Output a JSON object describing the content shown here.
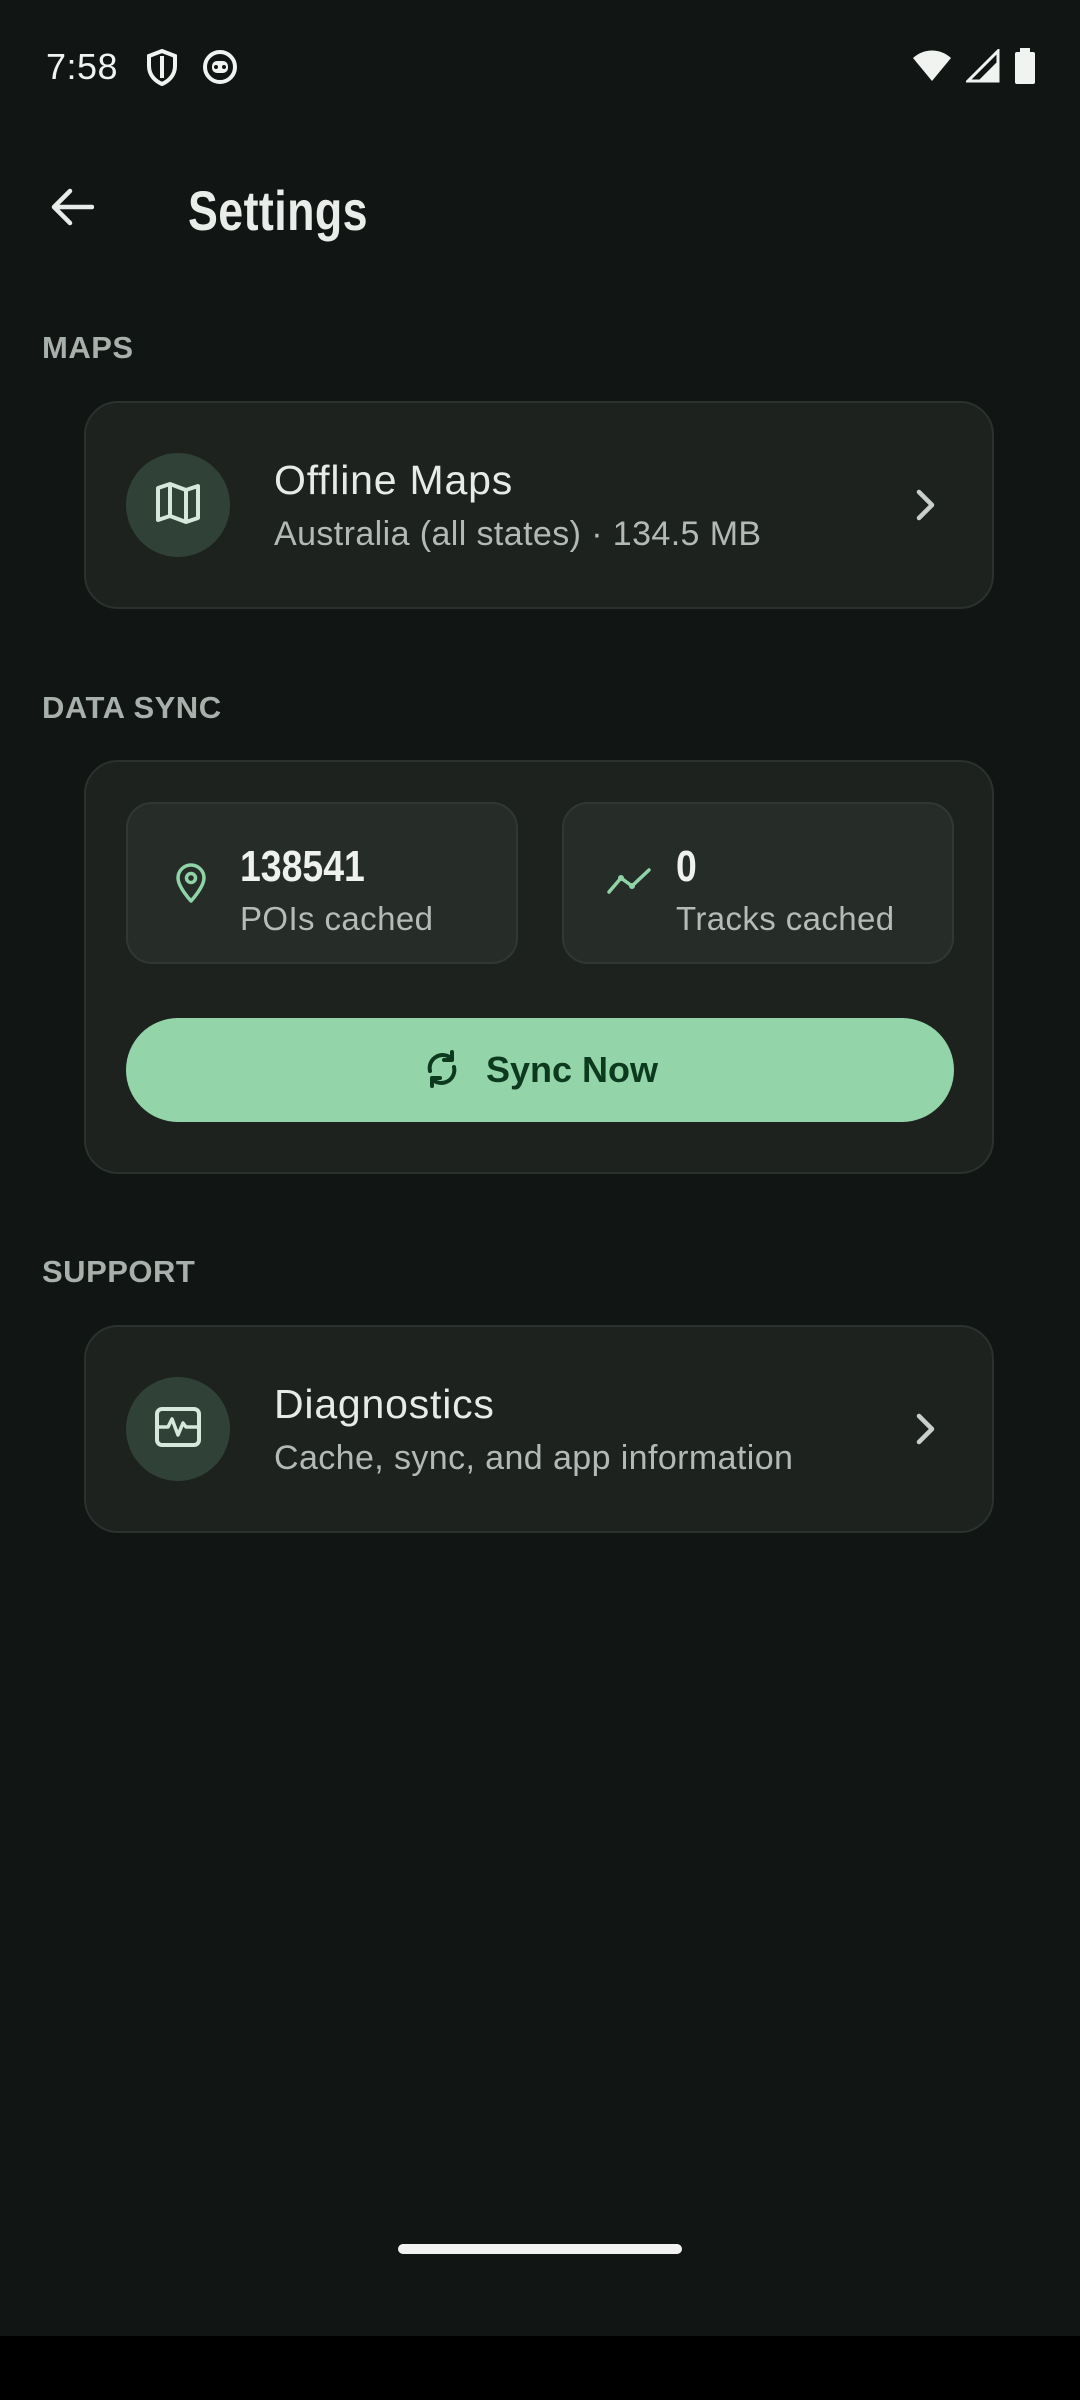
{
  "status_bar": {
    "time": "7:58"
  },
  "header": {
    "title": "Settings"
  },
  "sections": {
    "maps": {
      "title": "MAPS",
      "offline_maps": {
        "title": "Offline Maps",
        "subtitle": "Australia (all states) · 134.5 MB",
        "icon": "map-icon"
      }
    },
    "data_sync": {
      "title": "DATA SYNC",
      "pois": {
        "value": "138541",
        "label": "POIs cached",
        "icon": "location-pin-icon"
      },
      "tracks": {
        "value": "0",
        "label": "Tracks cached",
        "icon": "trend-line-icon"
      },
      "sync_button": {
        "label": "Sync Now",
        "icon": "sync-icon"
      }
    },
    "support": {
      "title": "SUPPORT",
      "diagnostics": {
        "title": "Diagnostics",
        "subtitle": "Cache, sync, and app information",
        "icon": "monitor-heart-icon"
      }
    }
  },
  "colors": {
    "background": "#111514",
    "card": "#1d221f",
    "accent": "#93d5a9",
    "accent_text": "#0d3a1f",
    "icon_green": "#8fd3a6"
  }
}
